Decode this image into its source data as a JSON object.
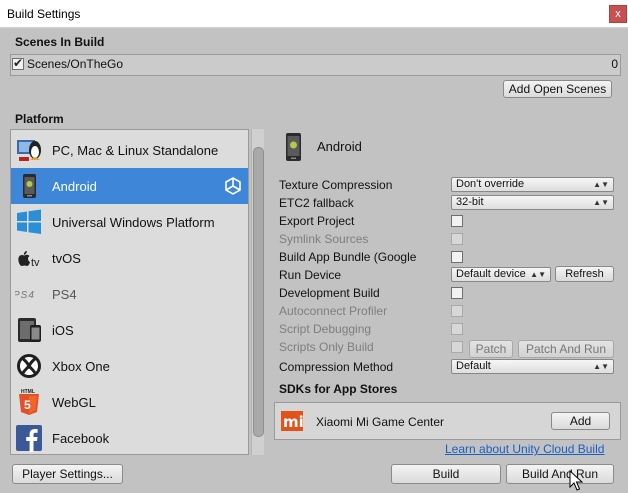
{
  "window": {
    "title": "Build Settings",
    "close_label": "x"
  },
  "scenes": {
    "heading": "Scenes In Build",
    "items": [
      {
        "name": "Scenes/OnTheGo",
        "index": "0",
        "checked": true
      }
    ],
    "add_open_scenes_label": "Add Open Scenes"
  },
  "platform": {
    "heading": "Platform",
    "items": [
      {
        "label": "PC, Mac & Linux Standalone",
        "icon": "standalone-icon"
      },
      {
        "label": "Android",
        "icon": "android-icon",
        "selected": true
      },
      {
        "label": "Universal Windows Platform",
        "icon": "windows-icon"
      },
      {
        "label": "tvOS",
        "icon": "appletv-icon"
      },
      {
        "label": "PS4",
        "icon": "ps4-icon"
      },
      {
        "label": "iOS",
        "icon": "ios-icon"
      },
      {
        "label": "Xbox One",
        "icon": "xbox-icon"
      },
      {
        "label": "WebGL",
        "icon": "html5-icon"
      },
      {
        "label": "Facebook",
        "icon": "facebook-icon"
      }
    ]
  },
  "android": {
    "title": "Android",
    "texture_compression": {
      "label": "Texture Compression",
      "value": "Don't override"
    },
    "etc2_fallback": {
      "label": "ETC2 fallback",
      "value": "32-bit"
    },
    "export_project": {
      "label": "Export Project"
    },
    "symlink_sources": {
      "label": "Symlink Sources"
    },
    "build_app_bundle": {
      "label": "Build App Bundle (Google"
    },
    "run_device": {
      "label": "Run Device",
      "value": "Default device",
      "refresh_label": "Refresh"
    },
    "development_build": {
      "label": "Development Build"
    },
    "autoconnect_profiler": {
      "label": "Autoconnect Profiler"
    },
    "script_debugging": {
      "label": "Script Debugging"
    },
    "scripts_only_build": {
      "label": "Scripts Only Build",
      "patch_label": "Patch",
      "patch_and_run_label": "Patch And Run"
    },
    "compression_method": {
      "label": "Compression Method",
      "value": "Default"
    }
  },
  "sdks": {
    "heading": "SDKs for App Stores",
    "store_name": "Xiaomi Mi Game Center",
    "store_logo_text": "mi",
    "add_label": "Add",
    "cloud_link": "Learn about Unity Cloud Build"
  },
  "footer": {
    "player_settings_label": "Player Settings...",
    "build_label": "Build",
    "build_and_run_label": "Build And Run"
  },
  "colors": {
    "selection": "#3d86d8",
    "mi_orange": "#e2521d",
    "link": "#1a5fc1"
  }
}
